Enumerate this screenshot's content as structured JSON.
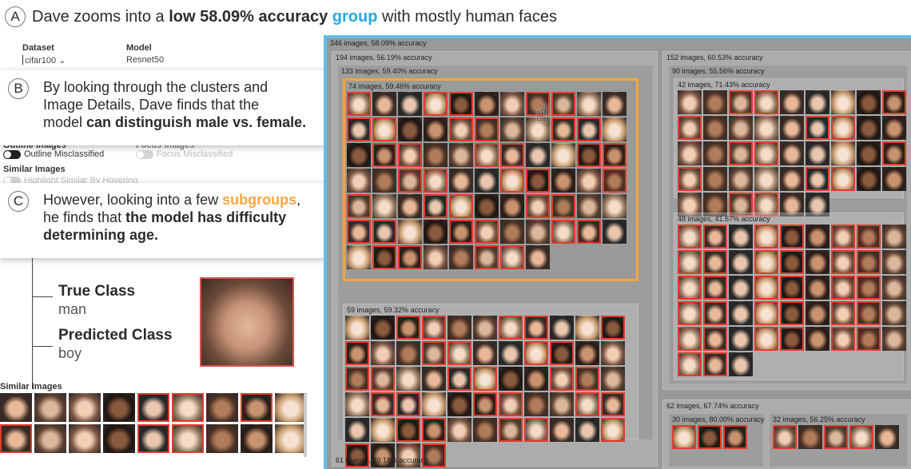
{
  "header": {
    "letter": "A",
    "t1": "Dave zooms into a ",
    "t2": "low 58.09% accuracy",
    "t3": " ",
    "t4": "group",
    "t5": " with mostly human faces"
  },
  "sidebar": {
    "dataset_label": "Dataset",
    "dataset_value": "cifar100",
    "dataset_caret": "⌄",
    "model_label": "Model",
    "model_value": "Resnet50",
    "outline_label": "Outline Images",
    "outline_toggle": "Outline Misclassified",
    "focus_label": "Focus Images",
    "focus_toggle": "Focus Misclassified",
    "similar_label": "Similar Images",
    "similar_toggle": "Highlight Similar By Hovering"
  },
  "callout_b": {
    "letter": "B",
    "l1": "By looking through the clusters and",
    "l2": "Image Details, Dave finds that the",
    "l3a": "model ",
    "l3b": "can distinguish male vs. female."
  },
  "callout_c": {
    "letter": "C",
    "l1a": "However, looking into a few ",
    "l1b": "subgroups",
    "l1c": ",",
    "l2a": "he finds that ",
    "l2b": "the model has difficulty",
    "l3": "determining age."
  },
  "details": {
    "true_class_label": "True Class",
    "true_class_value": "man",
    "pred_class_label": "Predicted Class",
    "pred_class_value": "boy"
  },
  "similar": {
    "title": "Similar Images",
    "red_indices": [
      4,
      5,
      7,
      9,
      13,
      14
    ]
  },
  "clusters": {
    "root": "346 images, 58.09% accuracy",
    "c194": "194 images, 56.19% accuracy",
    "c133": "133 images, 59.40% accuracy",
    "c74": "74 images, 59.46% accuracy",
    "c59": "59 images, 59.32% accuracy",
    "c61": "61 images, 49.18% accuracy",
    "c152": "152 images, 60.53% accuracy",
    "c90": "90 images, 55.56% accuracy",
    "c42": "42 images, 71.43% accuracy",
    "c48": "48 images, 41.67% accuracy",
    "c62": "62 images, 67.74% accuracy",
    "c30": "30 images, 80.00% accuracy",
    "c32": "32 images, 56.25% accuracy"
  },
  "colors": {
    "accent_blue": "#27a8e0",
    "accent_orange": "#f4a640",
    "misclassified_red": "#e23b2e"
  },
  "icons": {
    "cursor": "pointer-hand-icon"
  }
}
